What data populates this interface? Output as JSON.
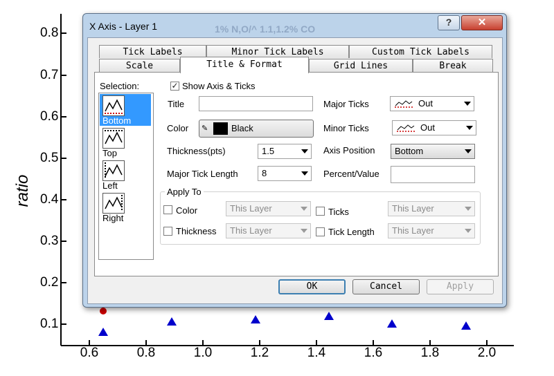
{
  "plot": {
    "ylabel": "ratio",
    "yticks": [
      "0.8",
      "0.7",
      "0.6",
      "0.5",
      "0.4",
      "0.3",
      "0.2",
      "0.1"
    ],
    "xticks": [
      "0.6",
      "0.8",
      "1.0",
      "1.2",
      "1.4",
      "1.6",
      "1.8",
      "2.0"
    ],
    "marker_color": "#0000cc",
    "red_marker_color": "#cc0000"
  },
  "dialog": {
    "title": "X Axis - Layer 1",
    "ghost_text": "1% N,O/^ 1.1,1.2% CO",
    "help_label": "?",
    "close_label": "✕",
    "tabs_row1": [
      "Tick Labels",
      "Minor Tick Labels",
      "Custom Tick Labels"
    ],
    "tabs_row2": [
      "Scale",
      "Title & Format",
      "Grid Lines",
      "Break"
    ],
    "active_tab": "Title & Format",
    "selection_label": "Selection:",
    "selection_items": [
      "Bottom",
      "Top",
      "Left",
      "Right"
    ],
    "show_axis_label": "Show Axis & Ticks",
    "show_axis_checked": true,
    "title_label": "Title",
    "title_value": "",
    "color_label": "Color",
    "color_value": "Black",
    "thickness_label": "Thickness(pts)",
    "thickness_value": "1.5",
    "major_tick_length_label": "Major Tick Length",
    "major_tick_length_value": "8",
    "major_ticks_label": "Major Ticks",
    "major_ticks_value": "Out",
    "minor_ticks_label": "Minor Ticks",
    "minor_ticks_value": "Out",
    "axis_position_label": "Axis Position",
    "axis_position_value": "Bottom",
    "percent_value_label": "Percent/Value",
    "percent_value_value": "",
    "apply_to_label": "Apply To",
    "apply_rows": [
      {
        "left_label": "Color",
        "left_value": "This Layer",
        "right_label": "Ticks",
        "right_value": "This Layer"
      },
      {
        "left_label": "Thickness",
        "left_value": "This Layer",
        "right_label": "Tick Length",
        "right_value": "This Layer"
      }
    ],
    "ok_label": "OK",
    "cancel_label": "Cancel",
    "apply_label": "Apply"
  }
}
